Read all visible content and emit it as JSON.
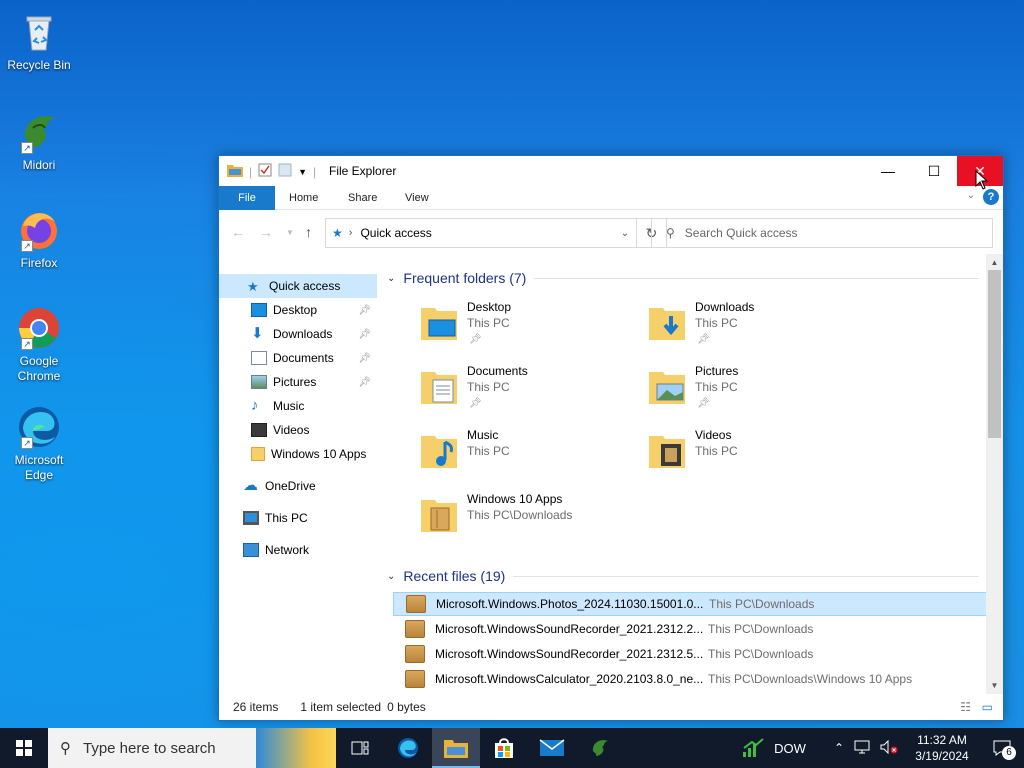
{
  "desktop": {
    "icons": [
      {
        "label": "Recycle Bin"
      },
      {
        "label": "Midori"
      },
      {
        "label": "Firefox"
      },
      {
        "label": "Google Chrome"
      },
      {
        "label": "Microsoft Edge"
      }
    ]
  },
  "window": {
    "title": "File Explorer",
    "ribbon_tabs": [
      "File",
      "Home",
      "Share",
      "View"
    ],
    "address": "Quick access",
    "search_placeholder": "Search Quick access",
    "nav": [
      {
        "label": "Quick access",
        "pinned": false
      },
      {
        "label": "Desktop",
        "pinned": true
      },
      {
        "label": "Downloads",
        "pinned": true
      },
      {
        "label": "Documents",
        "pinned": true
      },
      {
        "label": "Pictures",
        "pinned": true
      },
      {
        "label": "Music",
        "pinned": false
      },
      {
        "label": "Videos",
        "pinned": false
      },
      {
        "label": "Windows 10 Apps",
        "pinned": false
      },
      {
        "label": "OneDrive",
        "pinned": false
      },
      {
        "label": "This PC",
        "pinned": false
      },
      {
        "label": "Network",
        "pinned": false
      }
    ],
    "frequent_header": "Frequent folders (7)",
    "frequent": [
      {
        "name": "Desktop",
        "location": "This PC"
      },
      {
        "name": "Downloads",
        "location": "This PC"
      },
      {
        "name": "Documents",
        "location": "This PC"
      },
      {
        "name": "Pictures",
        "location": "This PC"
      },
      {
        "name": "Music",
        "location": "This PC"
      },
      {
        "name": "Videos",
        "location": "This PC"
      },
      {
        "name": "Windows 10 Apps",
        "location": "This PC\\Downloads"
      }
    ],
    "recent_header": "Recent files (19)",
    "recent": [
      {
        "name": "Microsoft.Windows.Photos_2024.11030.15001.0...",
        "location": "This PC\\Downloads"
      },
      {
        "name": "Microsoft.WindowsSoundRecorder_2021.2312.2...",
        "location": "This PC\\Downloads"
      },
      {
        "name": "Microsoft.WindowsSoundRecorder_2021.2312.5...",
        "location": "This PC\\Downloads"
      },
      {
        "name": "Microsoft.WindowsCalculator_2020.2103.8.0_ne...",
        "location": "This PC\\Downloads\\Windows 10 Apps"
      }
    ],
    "status": {
      "items": "26 items",
      "selected": "1 item selected",
      "size": "0 bytes"
    }
  },
  "taskbar": {
    "search_placeholder": "Type here to search",
    "stock": "DOW",
    "time": "11:32 AM",
    "date": "3/19/2024",
    "notifications": "6"
  }
}
